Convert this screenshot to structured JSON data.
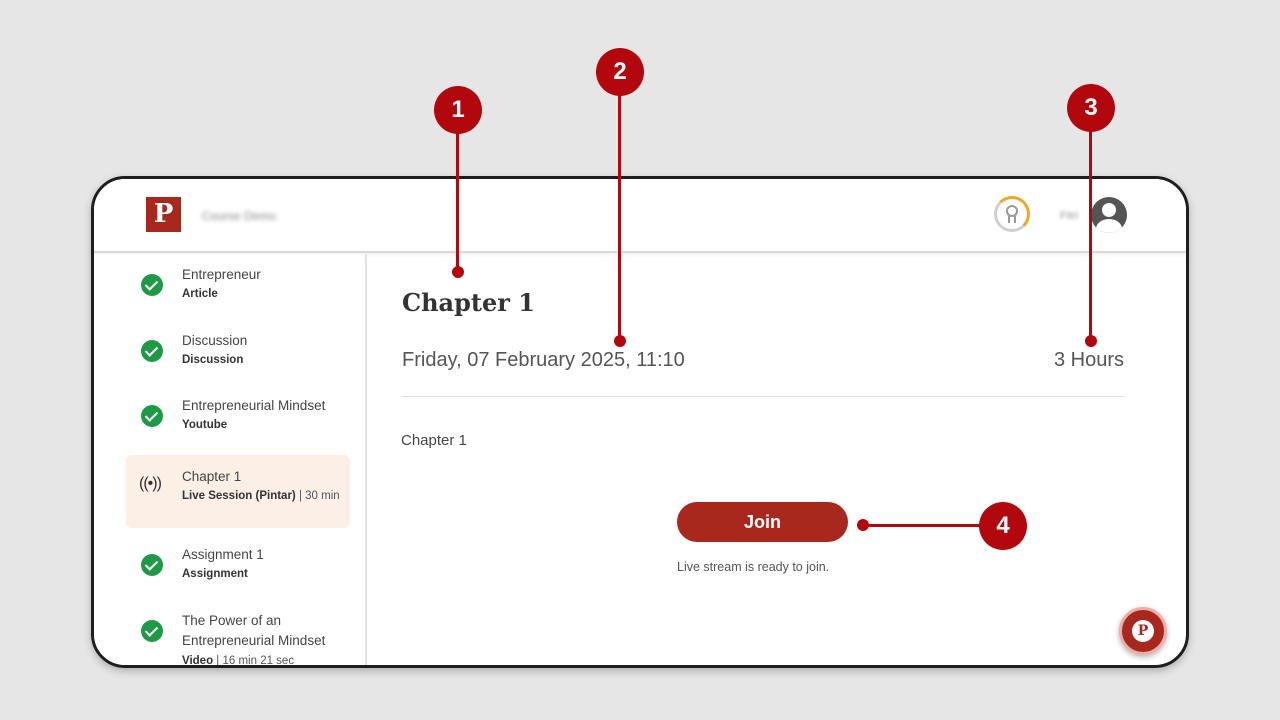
{
  "header": {
    "logo_letter": "P",
    "course_name": "Course Demo",
    "user_name": "Fitri"
  },
  "sidebar": {
    "items": [
      {
        "title": "Entrepreneur",
        "type": "Article",
        "status": "completed"
      },
      {
        "title": "Discussion",
        "type": "Discussion",
        "status": "completed"
      },
      {
        "title": "Entrepreneurial Mindset",
        "type": "Youtube",
        "status": "completed"
      },
      {
        "title": "Chapter 1",
        "type": "Live Session (Pintar)",
        "meta": " | 30 min",
        "status": "active"
      },
      {
        "title": "Assignment 1",
        "type": "Assignment",
        "status": "completed"
      },
      {
        "title": "The Power of an Entrepreneurial Mindset",
        "type": "Video",
        "meta": " | 16 min 21 sec",
        "status": "completed"
      }
    ]
  },
  "main": {
    "heading": "Chapter 1",
    "datetime": "Friday, 07 February 2025, 11:10",
    "duration": "3 Hours",
    "description": "Chapter 1",
    "join_label": "Join",
    "stream_status": "Live stream is ready to join."
  },
  "chat": {
    "fab_letter": "P"
  },
  "callouts": [
    "1",
    "2",
    "3",
    "4"
  ],
  "colors": {
    "brand": "#a8281e",
    "callout": "#b3070e",
    "success": "#1e9a47",
    "active_bg": "#fbefe6"
  }
}
